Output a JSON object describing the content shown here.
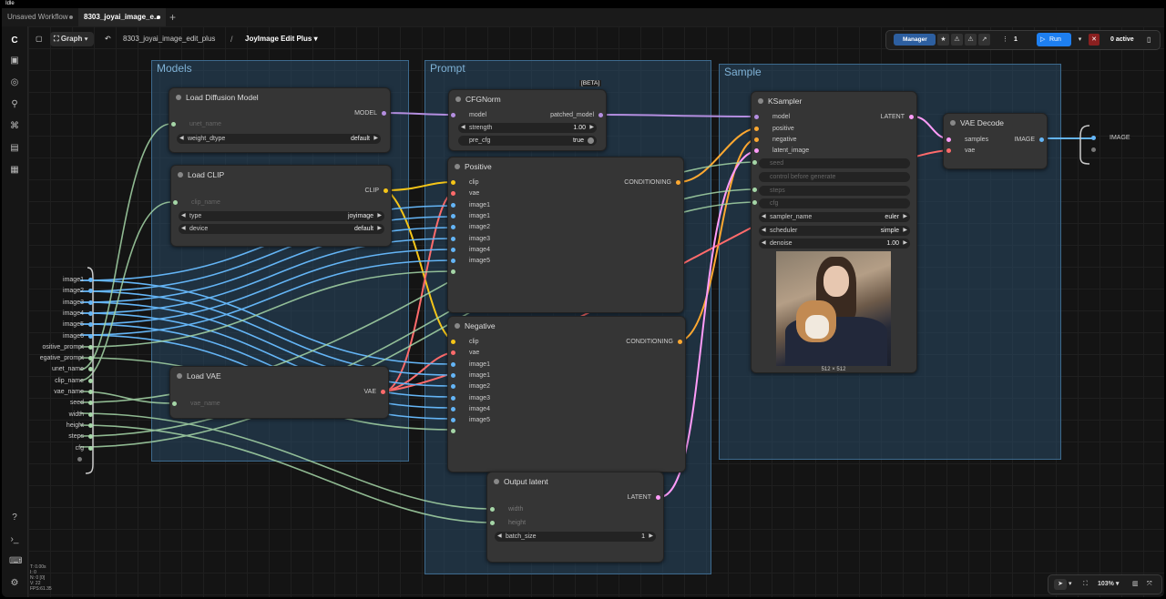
{
  "titlebar": {
    "text": "Idle"
  },
  "tabs": [
    {
      "label": "Unsaved Workflow"
    },
    {
      "label": "8303_joyai_image_e..."
    }
  ],
  "topbar": {
    "graph_label": "Graph",
    "breadcrumb": "8303_joyai_image_edit_plus",
    "separator": "/",
    "current": "JoyImage Edit Plus"
  },
  "runbar": {
    "manager": "Manager",
    "queue_count": "1",
    "run": "Run",
    "active": "0 active"
  },
  "groups": {
    "models": "Models",
    "prompt": "Prompt",
    "sample": "Sample"
  },
  "nodes": {
    "load_diffusion": {
      "title": "Load Diffusion Model",
      "out": "MODEL",
      "unet_name": "unet_name",
      "weight_dtype": "weight_dtype",
      "weight_dtype_value": "default"
    },
    "load_clip": {
      "title": "Load CLIP",
      "out": "CLIP",
      "clip_name": "clip_name",
      "type": "type",
      "type_value": "joyimage",
      "device": "device",
      "device_value": "default"
    },
    "load_vae": {
      "title": "Load VAE",
      "out": "VAE",
      "vae_name": "vae_name"
    },
    "cfgnorm": {
      "title": "CFGNorm",
      "badge": "[BETA]",
      "in": "model",
      "out": "patched_model",
      "strength": "strength",
      "strength_value": "1.00",
      "pre_cfg": "pre_cfg",
      "pre_cfg_value": "true"
    },
    "positive": {
      "title": "Positive",
      "out": "CONDITIONING",
      "inputs": [
        "clip",
        "vae",
        "image1",
        "image1",
        "image2",
        "image3",
        "image4",
        "image5"
      ]
    },
    "negative": {
      "title": "Negative",
      "out": "CONDITIONING",
      "inputs": [
        "clip",
        "vae",
        "image1",
        "image1",
        "image2",
        "image3",
        "image4",
        "image5"
      ]
    },
    "output_latent": {
      "title": "Output latent",
      "out": "LATENT",
      "width": "width",
      "height": "height",
      "batch_size": "batch_size",
      "batch_size_value": "1"
    },
    "ksampler": {
      "title": "KSampler",
      "out": "LATENT",
      "inputs": [
        "model",
        "positive",
        "negative",
        "latent_image"
      ],
      "seed": "seed",
      "control": "control before generate",
      "steps": "steps",
      "cfg": "cfg",
      "sampler_name": "sampler_name",
      "sampler_value": "euler",
      "scheduler": "scheduler",
      "scheduler_value": "simple",
      "denoise": "denoise",
      "denoise_value": "1.00",
      "image_size": "512 × 512"
    },
    "vae_decode": {
      "title": "VAE Decode",
      "inputs": [
        "samples",
        "vae"
      ],
      "out": "IMAGE"
    }
  },
  "reroute_image": {
    "label": "IMAGE"
  },
  "subgraph_inputs": [
    "image1",
    "image2",
    "image3",
    "image4",
    "image5",
    "image6",
    "ositive_prompt",
    "egative_prompt",
    "unet_name",
    "clip_name",
    "vae_name",
    "seed",
    "width",
    "height",
    "steps",
    "cfg"
  ],
  "stats": [
    "T: 0.00s",
    "I: 0",
    "N: 0 [0]",
    "V: 22",
    "FPS:61.35"
  ],
  "zoom": {
    "value": "103%"
  },
  "colors": {
    "model": "#b48ee0",
    "clip": "#f5c518",
    "vae": "#ff6b6b",
    "image": "#64b5f6",
    "conditioning": "#ffa931",
    "latent": "#ff9cf9",
    "widget": "#a5d6a7"
  }
}
